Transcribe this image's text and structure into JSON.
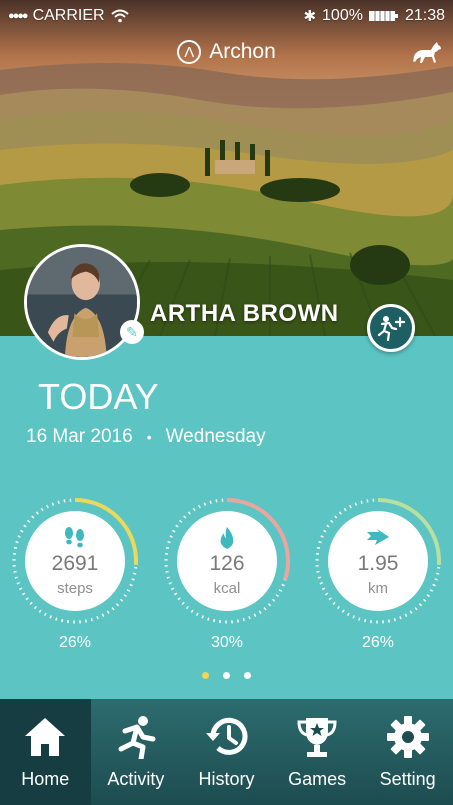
{
  "status_bar": {
    "carrier": "CARRIER",
    "battery": "100%",
    "time": "21:38"
  },
  "app": {
    "name": "Archon",
    "logo_mark": "Λ"
  },
  "profile": {
    "name": "ARTHA BROWN"
  },
  "today": {
    "title": "TODAY",
    "date": "16 Mar 2016",
    "separator": "•",
    "weekday": "Wednesday"
  },
  "stats": [
    {
      "icon": "footprints-icon",
      "value": "2691",
      "unit": "steps",
      "percent": "26%",
      "progress": 0.26,
      "arc_color": "#ecd95c"
    },
    {
      "icon": "flame-icon",
      "value": "126",
      "unit": "kcal",
      "percent": "30%",
      "progress": 0.3,
      "arc_color": "#e9a6a1"
    },
    {
      "icon": "arrow-icon",
      "value": "1.95",
      "unit": "km",
      "percent": "26%",
      "progress": 0.26,
      "arc_color": "#b9e0a0"
    }
  ],
  "pager": {
    "count": 3,
    "active": 0
  },
  "tabs": [
    {
      "label": "Home",
      "icon": "home-icon",
      "active": true
    },
    {
      "label": "Activity",
      "icon": "runner-icon",
      "active": false
    },
    {
      "label": "History",
      "icon": "history-icon",
      "active": false
    },
    {
      "label": "Games",
      "icon": "trophy-icon",
      "active": false
    },
    {
      "label": "Setting",
      "icon": "gear-icon",
      "active": false
    }
  ],
  "colors": {
    "accent": "#5cc5c4",
    "tabbar": "#1d4c50",
    "tab_active": "#163e42",
    "pager_active": "#f0d65a",
    "icon_teal": "#3fb8c0"
  }
}
